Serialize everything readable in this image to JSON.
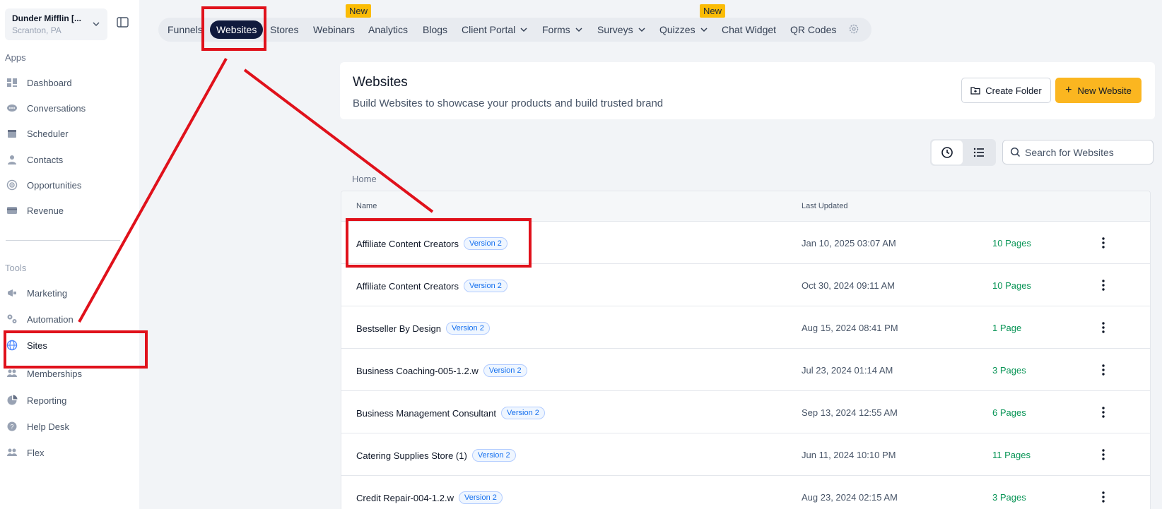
{
  "account": {
    "name": "Dunder Mifflin [...",
    "location": "Scranton, PA"
  },
  "sidebar": {
    "apps_label": "Apps",
    "tools_label": "Tools",
    "apps": [
      {
        "label": "Dashboard",
        "icon": "dashboard-icon"
      },
      {
        "label": "Conversations",
        "icon": "chat-icon"
      },
      {
        "label": "Scheduler",
        "icon": "calendar-icon"
      },
      {
        "label": "Contacts",
        "icon": "person-icon"
      },
      {
        "label": "Opportunities",
        "icon": "target-icon"
      },
      {
        "label": "Revenue",
        "icon": "card-icon"
      }
    ],
    "tools": [
      {
        "label": "Marketing",
        "icon": "megaphone-icon"
      },
      {
        "label": "Automation",
        "icon": "gears-icon"
      },
      {
        "label": "Sites",
        "icon": "globe-icon"
      },
      {
        "label": "Memberships",
        "icon": "people-icon"
      },
      {
        "label": "Reporting",
        "icon": "pie-icon"
      },
      {
        "label": "Help Desk",
        "icon": "help-icon"
      },
      {
        "label": "Flex",
        "icon": "people-icon"
      }
    ]
  },
  "topnav": {
    "tabs": [
      {
        "label": "Funnels"
      },
      {
        "label": "Websites"
      },
      {
        "label": "Stores"
      },
      {
        "label": "Webinars"
      },
      {
        "label": "Analytics"
      },
      {
        "label": "Blogs"
      },
      {
        "label": "Client Portal"
      },
      {
        "label": "Forms"
      },
      {
        "label": "Surveys"
      },
      {
        "label": "Quizzes"
      },
      {
        "label": "Chat Widget"
      },
      {
        "label": "QR Codes"
      }
    ],
    "badge": "New"
  },
  "header": {
    "title": "Websites",
    "subtitle": "Build Websites to showcase your products and build trusted brand",
    "create_folder": "Create Folder",
    "new_website": "New Website"
  },
  "search": {
    "placeholder": "Search for Websites"
  },
  "breadcrumb": "Home",
  "table": {
    "columns": {
      "name": "Name",
      "updated": "Last Updated"
    },
    "rows": [
      {
        "name": "Affiliate Content Creators",
        "version": "Version 2",
        "updated": "Jan 10, 2025 03:07 AM",
        "pages": "10 Pages"
      },
      {
        "name": "Affiliate Content Creators",
        "version": "Version 2",
        "updated": "Oct 30, 2024 09:11 AM",
        "pages": "10 Pages"
      },
      {
        "name": "Bestseller By Design",
        "version": "Version 2",
        "updated": "Aug 15, 2024 08:41 PM",
        "pages": "1 Page"
      },
      {
        "name": "Business Coaching-005-1.2.w",
        "version": "Version 2",
        "updated": "Jul 23, 2024 01:14 AM",
        "pages": "3 Pages"
      },
      {
        "name": "Business Management Consultant",
        "version": "Version 2",
        "updated": "Sep 13, 2024 12:55 AM",
        "pages": "6 Pages"
      },
      {
        "name": "Catering Supplies Store (1)",
        "version": "Version 2",
        "updated": "Jun 11, 2024 10:10 PM",
        "pages": "11 Pages"
      },
      {
        "name": "Credit Repair-004-1.2.w",
        "version": "Version 2",
        "updated": "Aug 23, 2024 02:15 AM",
        "pages": "3 Pages"
      }
    ]
  },
  "colors": {
    "accent": "#fbb620",
    "active_tab": "#101a3d",
    "annotation": "#e0111b",
    "pages_green": "#079455"
  }
}
